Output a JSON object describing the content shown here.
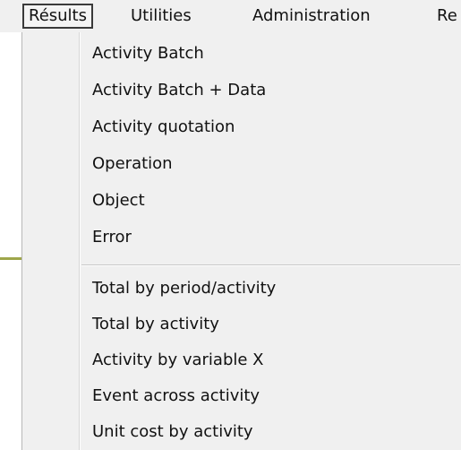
{
  "menubar": {
    "items": [
      {
        "label": "Résults",
        "active": true
      },
      {
        "label": "Utilities",
        "active": false
      },
      {
        "label": "Administration",
        "active": false
      },
      {
        "label": "Re",
        "active": false
      }
    ]
  },
  "menu": {
    "group1": [
      {
        "label": "Activity Batch"
      },
      {
        "label": "Activity Batch + Data"
      },
      {
        "label": "Activity quotation"
      },
      {
        "label": "Operation"
      },
      {
        "label": "Object"
      },
      {
        "label": "Error"
      }
    ],
    "group2": [
      {
        "label": "Total by period/activity"
      },
      {
        "label": "Total by activity"
      },
      {
        "label": "Activity by variable X"
      },
      {
        "label": "Event across activity"
      },
      {
        "label": "Unit cost by activity"
      }
    ]
  },
  "colors": {
    "menu_background": "#f0f0f0",
    "text": "#111111",
    "accent_line": "#9ea64a"
  }
}
